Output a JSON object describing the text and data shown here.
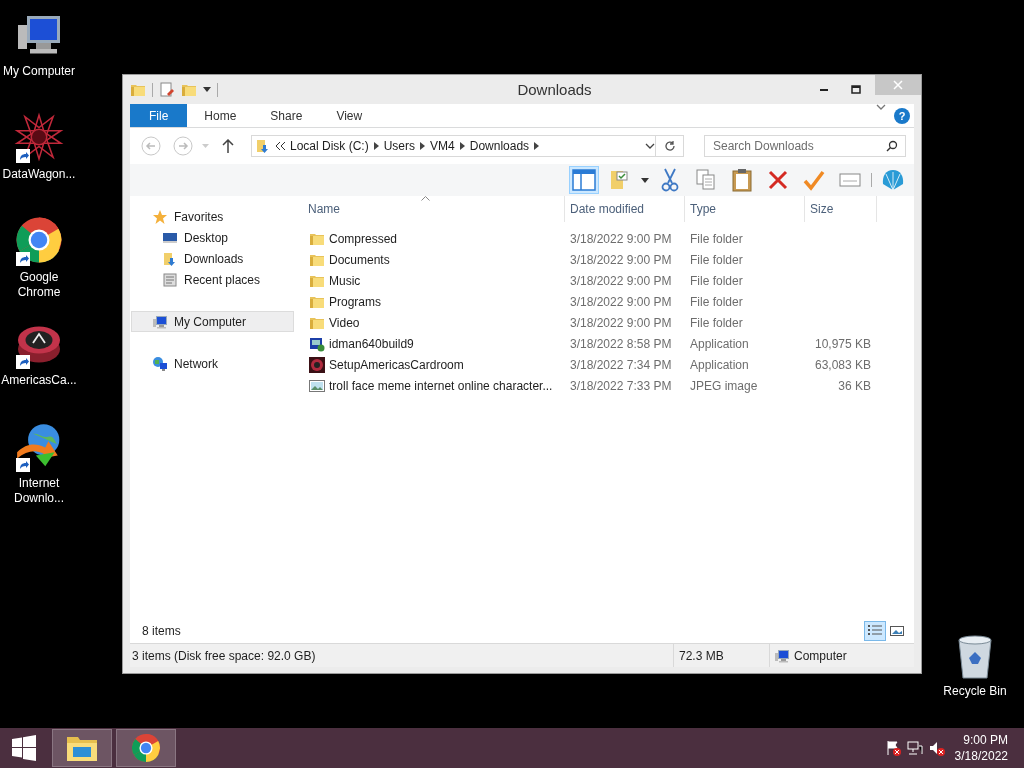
{
  "desktop_icons": [
    {
      "label": "My Computer",
      "kind": "computer",
      "shortcut": false
    },
    {
      "label": "DataWagon...",
      "kind": "star",
      "shortcut": true
    },
    {
      "label": "Google Chrome",
      "kind": "chrome",
      "shortcut": true
    },
    {
      "label": "AmericasCa...",
      "kind": "chip",
      "shortcut": true
    },
    {
      "label": "Internet Downlo...",
      "kind": "globe",
      "shortcut": true
    }
  ],
  "recycle_bin": {
    "label": "Recycle Bin"
  },
  "window": {
    "title": "Downloads",
    "tabs": [
      {
        "label": "File",
        "selected": true
      },
      {
        "label": "Home",
        "selected": false
      },
      {
        "label": "Share",
        "selected": false
      },
      {
        "label": "View",
        "selected": false
      }
    ],
    "help": "?",
    "address": {
      "segments": [
        "Local Disk (C:)",
        "Users",
        "VM4",
        "Downloads"
      ]
    },
    "search": {
      "placeholder": "Search Downloads"
    },
    "nav": [
      {
        "label": "Favorites",
        "kind": "star",
        "selected": false,
        "children": [
          {
            "label": "Desktop",
            "kind": "desktop",
            "selected": false
          },
          {
            "label": "Downloads",
            "kind": "downloads",
            "selected": false
          },
          {
            "label": "Recent places",
            "kind": "recent",
            "selected": false
          }
        ]
      },
      {
        "label": "My Computer",
        "kind": "computer",
        "selected": true
      },
      {
        "label": "Network",
        "kind": "network",
        "selected": false
      }
    ],
    "columns": [
      {
        "label": "Name",
        "sorted": true
      },
      {
        "label": "Date modified",
        "sorted": false
      },
      {
        "label": "Type",
        "sorted": false
      },
      {
        "label": "Size",
        "sorted": false
      }
    ],
    "rows": [
      {
        "kind": "folder",
        "name": "Compressed",
        "date": "3/18/2022 9:00 PM",
        "type": "File folder"
      },
      {
        "kind": "folder",
        "name": "Documents",
        "date": "3/18/2022 9:00 PM",
        "type": "File folder"
      },
      {
        "kind": "folder",
        "name": "Music",
        "date": "3/18/2022 9:00 PM",
        "type": "File folder"
      },
      {
        "kind": "folder",
        "name": "Programs",
        "date": "3/18/2022 9:00 PM",
        "type": "File folder"
      },
      {
        "kind": "folder",
        "name": "Video",
        "date": "3/18/2022 9:00 PM",
        "type": "File folder"
      },
      {
        "kind": "installer",
        "name": "idman640build9",
        "date": "3/18/2022 8:58 PM",
        "type": "Application",
        "size": "10,975 KB"
      },
      {
        "kind": "chip",
        "name": "SetupAmericasCardroom",
        "date": "3/18/2022 7:34 PM",
        "type": "Application",
        "size": "63,083 KB"
      },
      {
        "kind": "image",
        "name": "troll face meme internet online character...",
        "date": "3/18/2022 7:33 PM",
        "type": "JPEG image",
        "size": "36 KB"
      }
    ],
    "item_count": "8 items",
    "view_buttons": [
      {
        "kind": "details",
        "selected": true
      },
      {
        "kind": "thumbnails",
        "selected": false
      }
    ],
    "status_bar": {
      "selection": "3 items (Disk free space: 92.0 GB)",
      "size": "72.3 MB",
      "location": "Computer"
    }
  },
  "taskbar": {
    "apps": [
      {
        "kind": "explorer"
      },
      {
        "kind": "chrome"
      }
    ],
    "time": "9:00 PM",
    "date": "3/18/2022"
  }
}
